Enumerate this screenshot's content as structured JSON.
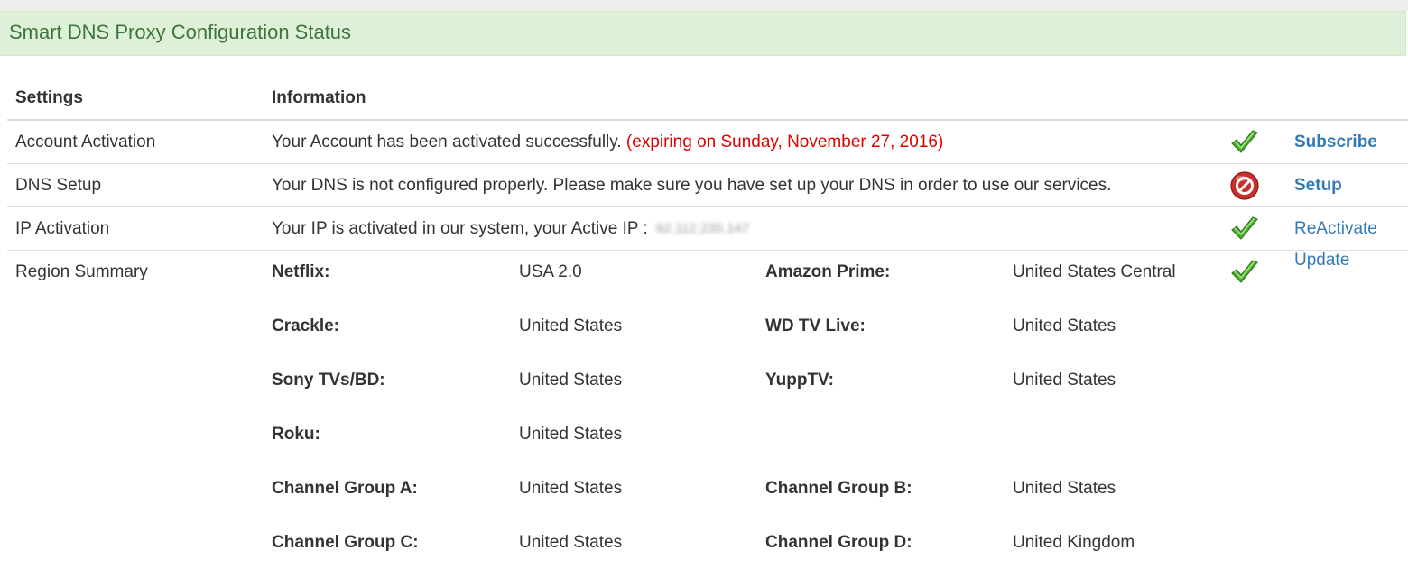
{
  "panel": {
    "title": "Smart DNS Proxy Configuration Status"
  },
  "table": {
    "headers": {
      "settings": "Settings",
      "information": "Information"
    },
    "rows": [
      {
        "setting": "Account Activation",
        "info": "Your Account has been activated successfully.",
        "info_extra": "(expiring on Sunday, November 27, 2016)",
        "status_icon": "check-icon",
        "action": "Subscribe"
      },
      {
        "setting": "DNS Setup",
        "info": "Your DNS is not configured properly. Please make sure you have set up your DNS in order to use our services.",
        "status_icon": "error-icon",
        "action": "Setup"
      },
      {
        "setting": "IP Activation",
        "info": "Your IP is activated in our system, your Active IP :",
        "ip_blurred": "62.112.235.147",
        "status_icon": "check-icon",
        "action": "ReActivate"
      }
    ],
    "region": {
      "setting": "Region Summary",
      "status_icon": "check-icon",
      "action": "Update",
      "services": [
        [
          {
            "name": "Netflix:",
            "value": "USA 2.0"
          },
          {
            "name": "Amazon Prime:",
            "value": "United States Central"
          }
        ],
        [
          {
            "name": "Crackle:",
            "value": "United States"
          },
          {
            "name": "WD TV Live:",
            "value": "United States"
          }
        ],
        [
          {
            "name": "Sony TVs/BD:",
            "value": "United States"
          },
          {
            "name": "YuppTV:",
            "value": "United States"
          }
        ],
        [
          {
            "name": "Roku:",
            "value": "United States"
          },
          {
            "name": "",
            "value": ""
          }
        ],
        [
          {
            "name": "Channel Group A:",
            "value": "United States"
          },
          {
            "name": "Channel Group B:",
            "value": "United States"
          }
        ],
        [
          {
            "name": "Channel Group C:",
            "value": "United States"
          },
          {
            "name": "Channel Group D:",
            "value": "United Kingdom"
          }
        ]
      ]
    }
  },
  "colors": {
    "heading_bg": "#dff0d8",
    "heading_text": "#3c763d",
    "link": "#337ab7",
    "expire": "#e00000",
    "check": "#4cae2c",
    "error": "#c9302c"
  }
}
